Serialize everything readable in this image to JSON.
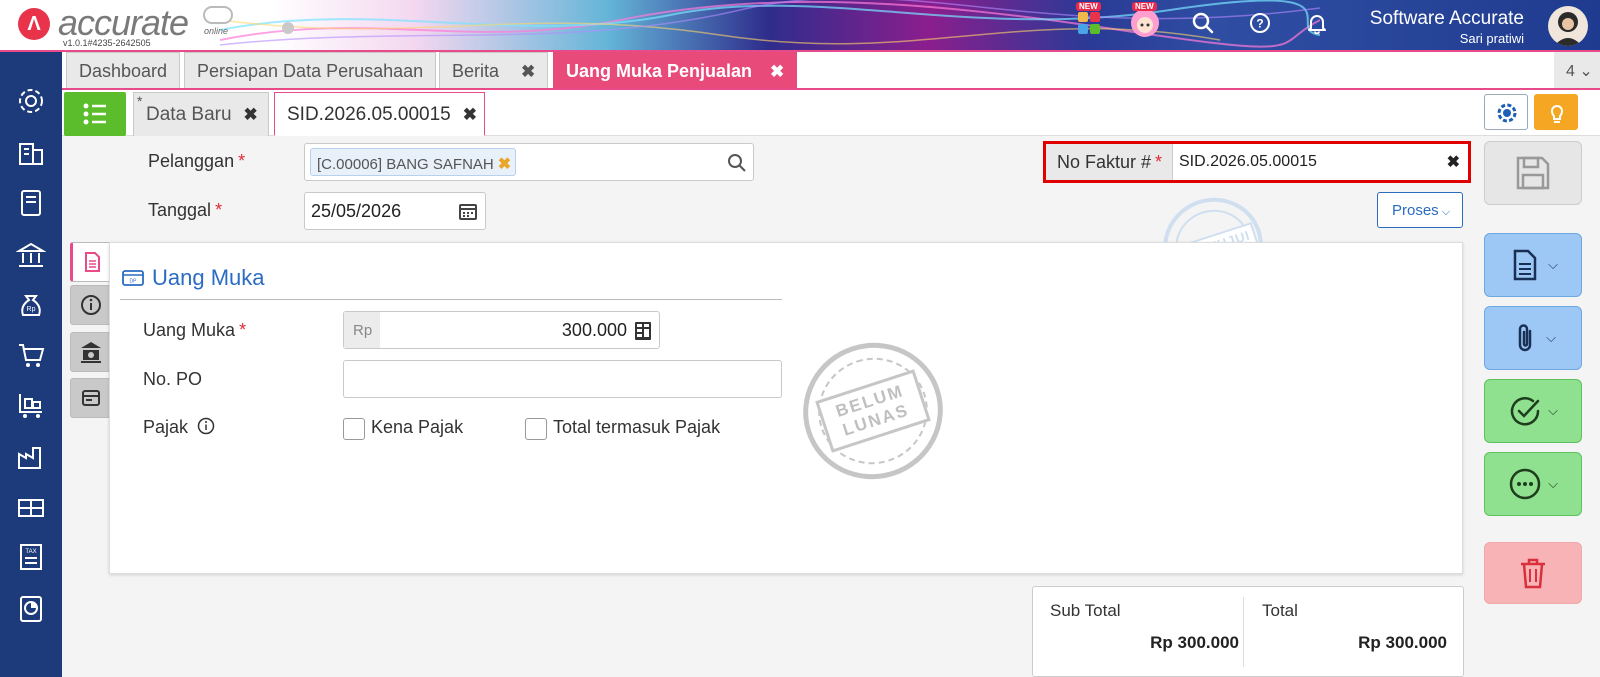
{
  "header": {
    "logo_text": "accurate",
    "logo_sub": "online",
    "version": "v1.0.1#4235-2642505",
    "new_badge_1": "NEW",
    "new_badge_2": "NEW",
    "company_name": "Software Accurate",
    "user_name": "Sari pratiwi"
  },
  "tabs": [
    {
      "label": "Dashboard"
    },
    {
      "label": "Persiapan Data Perusahaan"
    },
    {
      "label": "Berita",
      "close": "✖"
    },
    {
      "label": "Uang Muka Penjualan",
      "close": "✖"
    }
  ],
  "tab_count": "4 ⌄",
  "subtabs": [
    {
      "label": "Data Baru",
      "modified": "*",
      "close": "✖"
    },
    {
      "label": "SID.2026.05.00015",
      "close": "✖"
    }
  ],
  "form": {
    "pelanggan_label": "Pelanggan",
    "pelanggan_value": "[C.00006] BANG SAFNAH",
    "chip_remove": "✖",
    "tanggal_label": "Tanggal",
    "tanggal_value": "25/05/2026",
    "nofaktur_label": "No Faktur #",
    "nofaktur_value": "SID.2026.05.00015",
    "nofaktur_clear": "✖",
    "proses_label": "Proses",
    "required_mark": "*"
  },
  "panel": {
    "title": "Uang Muka",
    "uang_muka_label": "Uang Muka",
    "currency": "Rp",
    "uang_muka_value": "300.000",
    "nopo_label": "No. PO",
    "nopo_value": "",
    "pajak_label": "Pajak",
    "kena_pajak_label": "Kena Pajak",
    "total_termasuk_pajak_label": "Total termasuk Pajak"
  },
  "stamps": {
    "approved": "DISETUJUI",
    "unpaid_line1": "BELUM",
    "unpaid_line2": "LUNAS"
  },
  "totals": {
    "subtotal_label": "Sub Total",
    "subtotal_value": "Rp 300.000",
    "total_label": "Total",
    "total_value": "Rp 300.000"
  },
  "colors": {
    "accent_pink": "#e84a7a",
    "sidebar_navy": "#1d3a7a",
    "green_btn": "#5bbd2b",
    "highlight_red": "#e00000"
  }
}
